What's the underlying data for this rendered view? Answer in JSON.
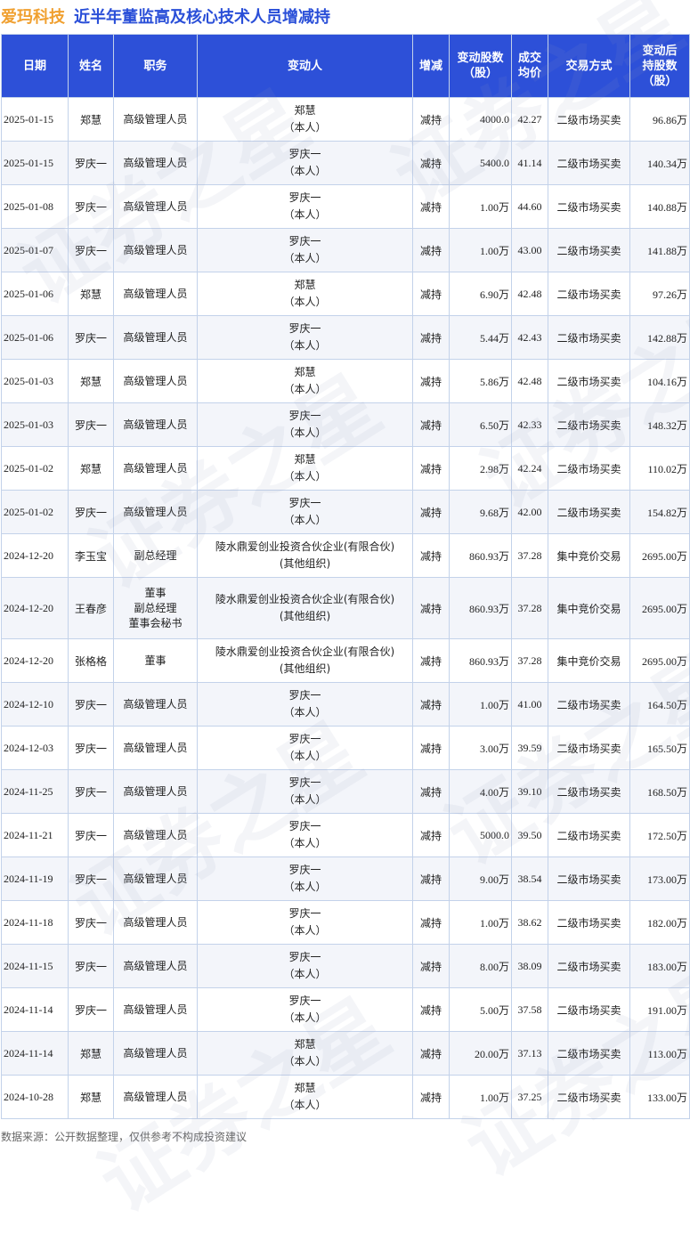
{
  "header": {
    "company": "爱玛科技",
    "subject": "近半年董监高及核心技术人员增减持"
  },
  "watermark": "证券之星",
  "columns": [
    {
      "lines": [
        "日期"
      ]
    },
    {
      "lines": [
        "姓名"
      ]
    },
    {
      "lines": [
        "职务"
      ]
    },
    {
      "lines": [
        "变动人"
      ]
    },
    {
      "lines": [
        "增减"
      ]
    },
    {
      "lines": [
        "变动股数",
        "（股）"
      ]
    },
    {
      "lines": [
        "成交",
        "均价"
      ]
    },
    {
      "lines": [
        "交易方式"
      ]
    },
    {
      "lines": [
        "变动后",
        "持股数",
        "（股）"
      ]
    }
  ],
  "rows": [
    {
      "date": "2025-01-15",
      "name": "郑慧",
      "position": [
        "高级管理人员"
      ],
      "changer": [
        "郑慧",
        "（本人）"
      ],
      "direction": "减持",
      "qty": "4000.0",
      "price": "42.27",
      "method": "二级市场买卖",
      "after": "96.86万"
    },
    {
      "date": "2025-01-15",
      "name": "罗庆一",
      "position": [
        "高级管理人员"
      ],
      "changer": [
        "罗庆一",
        "（本人）"
      ],
      "direction": "减持",
      "qty": "5400.0",
      "price": "41.14",
      "method": "二级市场买卖",
      "after": "140.34万"
    },
    {
      "date": "2025-01-08",
      "name": "罗庆一",
      "position": [
        "高级管理人员"
      ],
      "changer": [
        "罗庆一",
        "（本人）"
      ],
      "direction": "减持",
      "qty": "1.00万",
      "price": "44.60",
      "method": "二级市场买卖",
      "after": "140.88万"
    },
    {
      "date": "2025-01-07",
      "name": "罗庆一",
      "position": [
        "高级管理人员"
      ],
      "changer": [
        "罗庆一",
        "（本人）"
      ],
      "direction": "减持",
      "qty": "1.00万",
      "price": "43.00",
      "method": "二级市场买卖",
      "after": "141.88万"
    },
    {
      "date": "2025-01-06",
      "name": "郑慧",
      "position": [
        "高级管理人员"
      ],
      "changer": [
        "郑慧",
        "（本人）"
      ],
      "direction": "减持",
      "qty": "6.90万",
      "price": "42.48",
      "method": "二级市场买卖",
      "after": "97.26万"
    },
    {
      "date": "2025-01-06",
      "name": "罗庆一",
      "position": [
        "高级管理人员"
      ],
      "changer": [
        "罗庆一",
        "（本人）"
      ],
      "direction": "减持",
      "qty": "5.44万",
      "price": "42.43",
      "method": "二级市场买卖",
      "after": "142.88万"
    },
    {
      "date": "2025-01-03",
      "name": "郑慧",
      "position": [
        "高级管理人员"
      ],
      "changer": [
        "郑慧",
        "（本人）"
      ],
      "direction": "减持",
      "qty": "5.86万",
      "price": "42.48",
      "method": "二级市场买卖",
      "after": "104.16万"
    },
    {
      "date": "2025-01-03",
      "name": "罗庆一",
      "position": [
        "高级管理人员"
      ],
      "changer": [
        "罗庆一",
        "（本人）"
      ],
      "direction": "减持",
      "qty": "6.50万",
      "price": "42.33",
      "method": "二级市场买卖",
      "after": "148.32万"
    },
    {
      "date": "2025-01-02",
      "name": "郑慧",
      "position": [
        "高级管理人员"
      ],
      "changer": [
        "郑慧",
        "（本人）"
      ],
      "direction": "减持",
      "qty": "2.98万",
      "price": "42.24",
      "method": "二级市场买卖",
      "after": "110.02万"
    },
    {
      "date": "2025-01-02",
      "name": "罗庆一",
      "position": [
        "高级管理人员"
      ],
      "changer": [
        "罗庆一",
        "（本人）"
      ],
      "direction": "减持",
      "qty": "9.68万",
      "price": "42.00",
      "method": "二级市场买卖",
      "after": "154.82万"
    },
    {
      "date": "2024-12-20",
      "name": "李玉宝",
      "position": [
        "副总经理"
      ],
      "changer": [
        "陵水鼎爱创业投资合伙企业(有限合伙)",
        "(其他组织)"
      ],
      "direction": "减持",
      "qty": "860.93万",
      "price": "37.28",
      "method": "集中竞价交易",
      "after": "2695.00万"
    },
    {
      "date": "2024-12-20",
      "name": "王春彦",
      "position": [
        "董事",
        "副总经理",
        "董事会秘书"
      ],
      "changer": [
        "陵水鼎爱创业投资合伙企业(有限合伙)",
        "(其他组织)"
      ],
      "direction": "减持",
      "qty": "860.93万",
      "price": "37.28",
      "method": "集中竞价交易",
      "after": "2695.00万"
    },
    {
      "date": "2024-12-20",
      "name": "张格格",
      "position": [
        "董事"
      ],
      "changer": [
        "陵水鼎爱创业投资合伙企业(有限合伙)",
        "(其他组织)"
      ],
      "direction": "减持",
      "qty": "860.93万",
      "price": "37.28",
      "method": "集中竞价交易",
      "after": "2695.00万"
    },
    {
      "date": "2024-12-10",
      "name": "罗庆一",
      "position": [
        "高级管理人员"
      ],
      "changer": [
        "罗庆一",
        "（本人）"
      ],
      "direction": "减持",
      "qty": "1.00万",
      "price": "41.00",
      "method": "二级市场买卖",
      "after": "164.50万"
    },
    {
      "date": "2024-12-03",
      "name": "罗庆一",
      "position": [
        "高级管理人员"
      ],
      "changer": [
        "罗庆一",
        "（本人）"
      ],
      "direction": "减持",
      "qty": "3.00万",
      "price": "39.59",
      "method": "二级市场买卖",
      "after": "165.50万"
    },
    {
      "date": "2024-11-25",
      "name": "罗庆一",
      "position": [
        "高级管理人员"
      ],
      "changer": [
        "罗庆一",
        "（本人）"
      ],
      "direction": "减持",
      "qty": "4.00万",
      "price": "39.10",
      "method": "二级市场买卖",
      "after": "168.50万"
    },
    {
      "date": "2024-11-21",
      "name": "罗庆一",
      "position": [
        "高级管理人员"
      ],
      "changer": [
        "罗庆一",
        "（本人）"
      ],
      "direction": "减持",
      "qty": "5000.0",
      "price": "39.50",
      "method": "二级市场买卖",
      "after": "172.50万"
    },
    {
      "date": "2024-11-19",
      "name": "罗庆一",
      "position": [
        "高级管理人员"
      ],
      "changer": [
        "罗庆一",
        "（本人）"
      ],
      "direction": "减持",
      "qty": "9.00万",
      "price": "38.54",
      "method": "二级市场买卖",
      "after": "173.00万"
    },
    {
      "date": "2024-11-18",
      "name": "罗庆一",
      "position": [
        "高级管理人员"
      ],
      "changer": [
        "罗庆一",
        "（本人）"
      ],
      "direction": "减持",
      "qty": "1.00万",
      "price": "38.62",
      "method": "二级市场买卖",
      "after": "182.00万"
    },
    {
      "date": "2024-11-15",
      "name": "罗庆一",
      "position": [
        "高级管理人员"
      ],
      "changer": [
        "罗庆一",
        "（本人）"
      ],
      "direction": "减持",
      "qty": "8.00万",
      "price": "38.09",
      "method": "二级市场买卖",
      "after": "183.00万"
    },
    {
      "date": "2024-11-14",
      "name": "罗庆一",
      "position": [
        "高级管理人员"
      ],
      "changer": [
        "罗庆一",
        "（本人）"
      ],
      "direction": "减持",
      "qty": "5.00万",
      "price": "37.58",
      "method": "二级市场买卖",
      "after": "191.00万"
    },
    {
      "date": "2024-11-14",
      "name": "郑慧",
      "position": [
        "高级管理人员"
      ],
      "changer": [
        "郑慧",
        "（本人）"
      ],
      "direction": "减持",
      "qty": "20.00万",
      "price": "37.13",
      "method": "二级市场买卖",
      "after": "113.00万"
    },
    {
      "date": "2024-10-28",
      "name": "郑慧",
      "position": [
        "高级管理人员"
      ],
      "changer": [
        "郑慧",
        "（本人）"
      ],
      "direction": "减持",
      "qty": "1.00万",
      "price": "37.25",
      "method": "二级市场买卖",
      "after": "133.00万"
    }
  ],
  "footer": "数据来源：公开数据整理，仅供参考不构成投资建议",
  "colors": {
    "header_bg": "#2d50d8",
    "company": "#f0a030",
    "subject": "#2a4fd8",
    "decrease": "#1a9a3a",
    "border": "#c3d2ea"
  }
}
